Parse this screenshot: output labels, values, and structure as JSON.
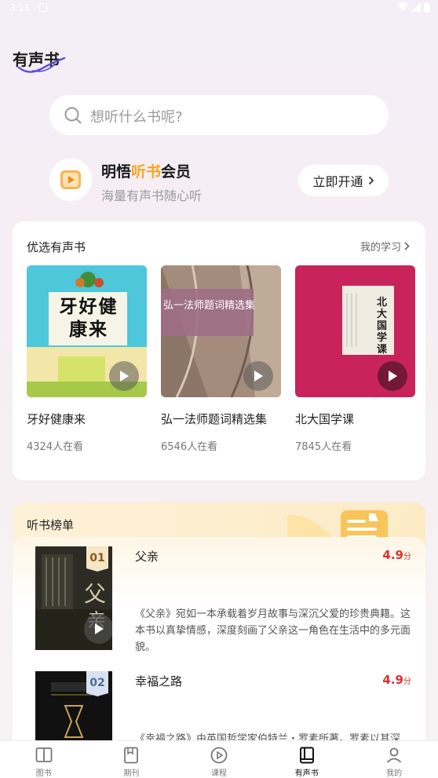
{
  "status": {
    "time": "3:13"
  },
  "brand": {
    "title": "有声书"
  },
  "search": {
    "placeholder": "想听什么书呢?"
  },
  "vip": {
    "title_prefix": "明悟",
    "title_highlight": "听书",
    "title_suffix": "会员",
    "subtitle": "海量有声书随心听",
    "button": "立即开通"
  },
  "featured": {
    "header": "优选有声书",
    "more": "我的学习",
    "books": [
      {
        "name": "牙好健康来",
        "listeners": "4324人在看",
        "cover_text": "牙好健康来"
      },
      {
        "name": "弘一法师题词精选集",
        "listeners": "6546人在看",
        "cover_text": "弘一法师题词精选集"
      },
      {
        "name": "北大国学课",
        "listeners": "7845人在看",
        "cover_text": "北大国学课"
      }
    ]
  },
  "ranking": {
    "header": "听书榜单",
    "items": [
      {
        "rank": "01",
        "title": "父亲",
        "score": "4.9",
        "unit": "分",
        "desc": "《父亲》宛如一本承载着岁月故事与深沉父爱的珍贵典籍。这本书以真挚情感，深度刻画了父亲这一角色在生活中的多元面貌。"
      },
      {
        "rank": "02",
        "title": "幸福之路",
        "score": "4.9",
        "unit": "分",
        "desc": "《幸福之路》由英国哲学家伯特兰・罗素所著。罗素以其深"
      }
    ]
  },
  "tabs": [
    {
      "label": "图书",
      "icon": "book-open-icon"
    },
    {
      "label": "期刊",
      "icon": "journal-icon"
    },
    {
      "label": "课程",
      "icon": "play-circle-icon"
    },
    {
      "label": "有声书",
      "icon": "audiobook-icon",
      "active": true
    },
    {
      "label": "我的",
      "icon": "user-icon"
    }
  ],
  "colors": {
    "accent": "#f5a623",
    "score": "#e0302c"
  }
}
